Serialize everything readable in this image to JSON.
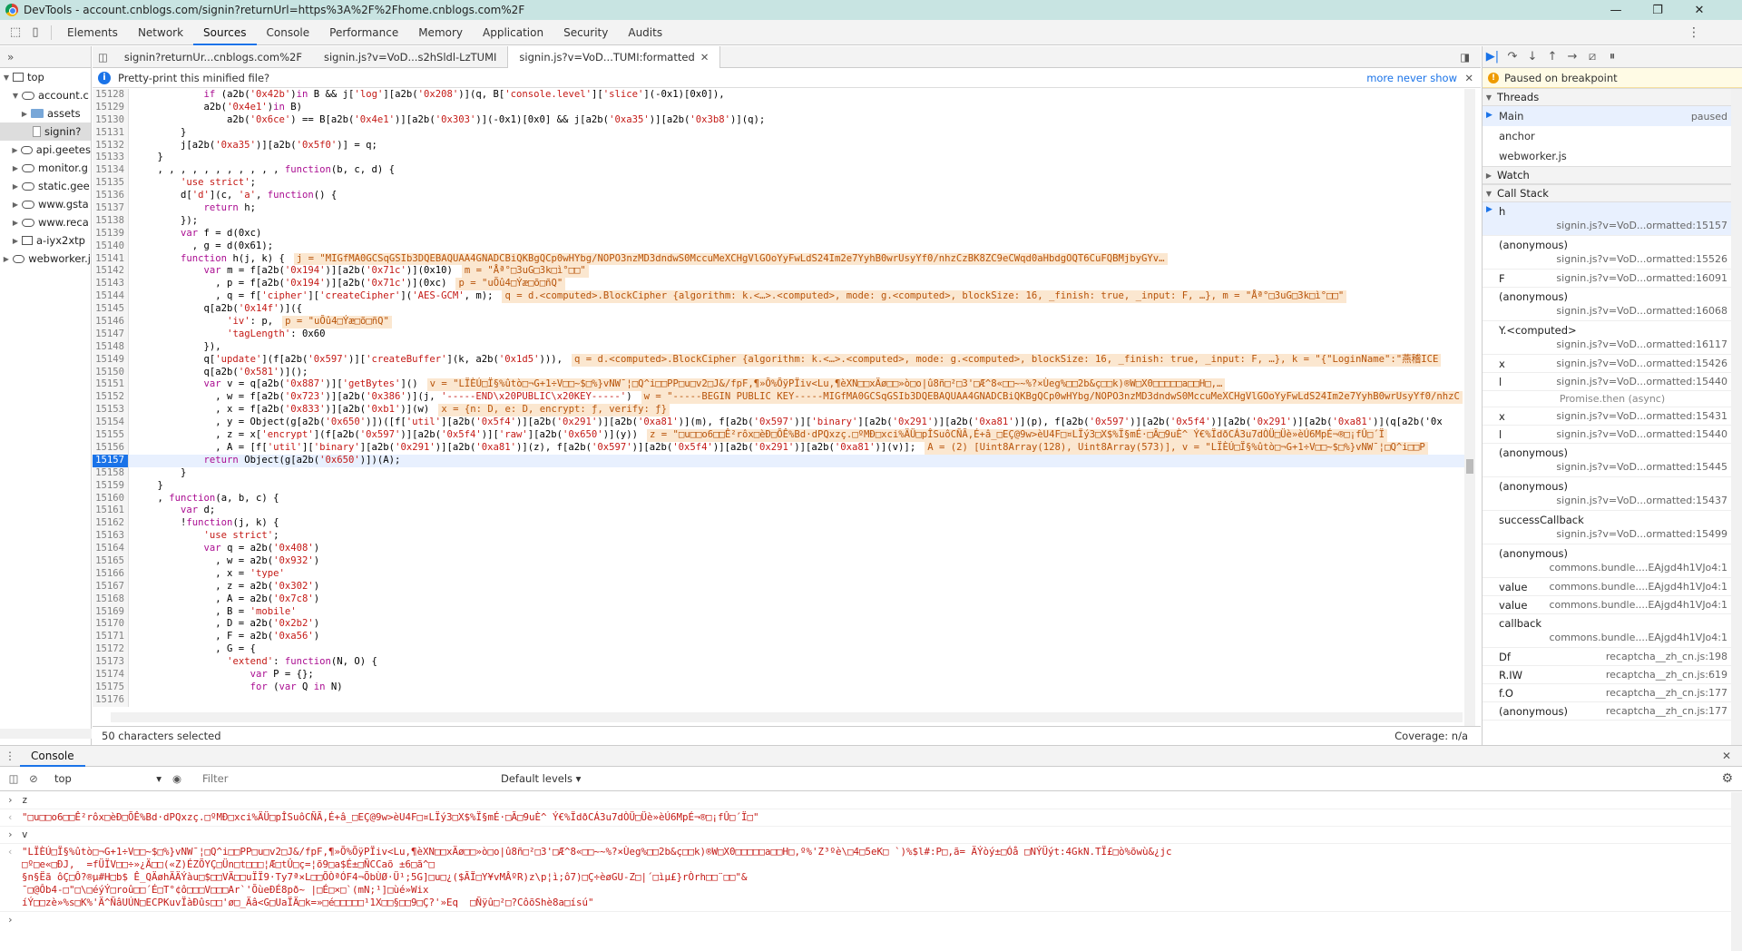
{
  "window": {
    "title": "DevTools - account.cnblogs.com/signin?returnUrl=https%3A%2F%2Fhome.cnblogs.com%2F",
    "minimize": "—",
    "restore": "❐",
    "close": "✕"
  },
  "devtools_tabs": [
    "Elements",
    "Network",
    "Sources",
    "Console",
    "Performance",
    "Memory",
    "Application",
    "Security",
    "Audits"
  ],
  "active_tab": "Sources",
  "navigator": {
    "header": "»",
    "items": [
      {
        "label": "top",
        "indent": 0,
        "icon": "frame"
      },
      {
        "label": "account.c",
        "indent": 1,
        "icon": "cloud"
      },
      {
        "label": "assets",
        "indent": 2,
        "icon": "folder"
      },
      {
        "label": "signin?",
        "indent": 2,
        "icon": "doc"
      },
      {
        "label": "api.geetes",
        "indent": 1,
        "icon": "cloud"
      },
      {
        "label": "monitor.g",
        "indent": 1,
        "icon": "cloud"
      },
      {
        "label": "static.gee",
        "indent": 1,
        "icon": "cloud"
      },
      {
        "label": "www.gsta",
        "indent": 1,
        "icon": "cloud"
      },
      {
        "label": "www.reca",
        "indent": 1,
        "icon": "cloud"
      },
      {
        "label": "a-iyx2xtp",
        "indent": 1,
        "icon": "frame"
      },
      {
        "label": "webworker.j",
        "indent": 0,
        "icon": "cloud"
      }
    ]
  },
  "file_tabs": [
    {
      "label": "signin?returnUr...cnblogs.com%2F",
      "active": false
    },
    {
      "label": "signin.js?v=VoD...s2hSldl-LzTUMI",
      "active": false
    },
    {
      "label": "signin.js?v=VoD...TUMI:formatted",
      "active": true
    }
  ],
  "infobar": {
    "text": "Pretty-print this minified file?",
    "more": "more",
    "never": "never show"
  },
  "code_lines": [
    {
      "n": "15128",
      "t": "            if (a2b('0x42b')in B && j['log'][a2b('0x208')](q, B['console.level']['slice'](-0x1)[0x0]),",
      "i": ""
    },
    {
      "n": "15129",
      "t": "            a2b('0x4e1')in B)",
      "i": ""
    },
    {
      "n": "15130",
      "t": "                a2b('0x6ce') == B[a2b('0x4e1')][a2b('0x303')](-0x1)[0x0] && j[a2b('0xa35')][a2b('0x3b8')](q);",
      "i": ""
    },
    {
      "n": "15131",
      "t": "        }",
      "i": ""
    },
    {
      "n": "15132",
      "t": "        j[a2b('0xa35')][a2b('0x5f0')] = q;",
      "i": ""
    },
    {
      "n": "15133",
      "t": "    }",
      "i": ""
    },
    {
      "n": "15134",
      "t": "    , , , , , , , , , , , function(b, c, d) {",
      "i": ""
    },
    {
      "n": "15135",
      "t": "        'use strict';",
      "i": ""
    },
    {
      "n": "15136",
      "t": "        d['d'](c, 'a', function() {",
      "i": ""
    },
    {
      "n": "15137",
      "t": "            return h;",
      "i": ""
    },
    {
      "n": "15138",
      "t": "        });",
      "i": ""
    },
    {
      "n": "15139",
      "t": "        var f = d(0xc)",
      "i": ""
    },
    {
      "n": "15140",
      "t": "          , g = d(0x61);",
      "i": ""
    },
    {
      "n": "15141",
      "t": "        function h(j, k) {",
      "i": "j = \"MIGfMA0GCSqGSIb3DQEBAQUAA4GNADCBiQKBgQCp0wHYbg/NOPO3nzMD3dndwS0MccuMeXCHgVlGOoYyFwLdS24Im2e7YyhB0wrUsyYf0/nhzCzBK8ZC9eCWqd0aHbdgOQT6CuFQBMjbyGYv…"
    },
    {
      "n": "15142",
      "t": "            var m = f[a2b('0x194')][a2b('0x71c')](0x10)",
      "i": "m = \"Åª°□3uG□3k□ì°□□\""
    },
    {
      "n": "15143",
      "t": "              , p = f[a2b('0x194')][a2b('0x71c')](0xc)",
      "i": "p = \"uÕû4□Ýæ□õ□ñQ\""
    },
    {
      "n": "15144",
      "t": "              , q = f['cipher']['createCipher']('AES-GCM', m);",
      "i": "q = d.<computed>.BlockCipher {algorithm: k.<…>.<computed>, mode: g.<computed>, blockSize: 16, _finish: true, _input: F, …}, m = \"Åª°□3uG□3k□ì°□□\""
    },
    {
      "n": "15145",
      "t": "            q[a2b('0x14f')]({",
      "i": ""
    },
    {
      "n": "15146",
      "t": "                'iv': p,",
      "i": "p = \"uÕû4□Ýæ□õ□ñQ\""
    },
    {
      "n": "15147",
      "t": "                'tagLength': 0x60",
      "i": ""
    },
    {
      "n": "15148",
      "t": "            }),",
      "i": ""
    },
    {
      "n": "15149",
      "t": "            q['update'](f[a2b('0x597')]['createBuffer'](k, a2b('0x1d5'))),",
      "i": "q = d.<computed>.BlockCipher {algorithm: k.<…>.<computed>, mode: g.<computed>, blockSize: 16, _finish: true, _input: F, …}, k = \"{\"LoginName\":\"燕稽ICE"
    },
    {
      "n": "15150",
      "t": "            q[a2b('0x581')]();",
      "i": ""
    },
    {
      "n": "15151",
      "t": "            var v = q[a2b('0x887')]['getBytes']()",
      "i": "v = \"LÏÈÚ□Ï§%ûtò□¬G+1÷V□□~$□%}vNW¯¦□Q^i□□PP□u□v2□J&/fpF,¶»Õ%ÕÿPÏiv<Lu,¶èXN□□xÄø□□»ò□o|û8ñ□²□3'□Æ^8«□□~~%?×Ùeg%□□2b&ç□□k)®W□X0□□□□□a□□H□,…"
    },
    {
      "n": "15152",
      "t": "              , w = f[a2b('0x723')][a2b('0x386')](j, '-----END\\x20PUBLIC\\x20KEY-----')",
      "i": "w = \"-----BEGIN PUBLIC KEY-----MIGfMA0GCSqGSIb3DQEBAQUAA4GNADCBiQKBgQCp0wHYbg/NOPO3nzMD3dndwS0MccuMeXCHgVlGOoYyFwLdS24Im2e7YyhB0wrUsyYf0/nhzC"
    },
    {
      "n": "15153",
      "t": "              , x = f[a2b('0x833')][a2b('0xb1')](w)",
      "i": "x = {n: D, e: D, encrypt: ƒ, verify: ƒ}"
    },
    {
      "n": "15154",
      "t": "              , y = Object(g[a2b('0x650')])([f['util'][a2b('0x5f4')][a2b('0x291')][a2b('0xa81')](m), f[a2b('0x597')]['binary'][a2b('0x291')][a2b('0xa81')](p), f[a2b('0x597')][a2b('0x5f4')][a2b('0x291')][a2b('0xa81')](q[a2b('0x",
      "i": ""
    },
    {
      "n": "15155",
      "t": "              , z = x['encrypt'](f[a2b('0x597')][a2b('0x5f4')]['raw'][a2b('0x650')](y))",
      "i": "z = \"□u□□o6□□Ê²rôx□èÐ□ÕÊ%Bd·dPQxzç.□ºMÐ□xci%ÄÜ□pÎSuôCÑÃ,É+â_□EÇ@9w>èU4F□¤LÏý3□X$%Ï§mÉ·□Ã□9uÈ^ Ý€%ÏdðCÁ3u7dÒÜ□Üè»èÚ6MpÉ¬®□¡fÛ□´Ï"
    },
    {
      "n": "15156",
      "t": "              , A = [f['util']['binary'][a2b('0x291')][a2b('0xa81')](z), f[a2b('0x597')][a2b('0x5f4')][a2b('0x291')][a2b('0xa81')](v)];",
      "i": "A = (2) [Uint8Array(128), Uint8Array(573)], v = \"LÏÈÚ□Ï§%ûtò□¬G+1÷V□□~$□%}vNW¯¦□Q^i□□P"
    },
    {
      "n": "15157",
      "t": "            return Object(g[a2b('0x650')])(A);",
      "i": "",
      "current": true
    },
    {
      "n": "15158",
      "t": "        }",
      "i": ""
    },
    {
      "n": "15159",
      "t": "    }",
      "i": ""
    },
    {
      "n": "15160",
      "t": "    , function(a, b, c) {",
      "i": ""
    },
    {
      "n": "15161",
      "t": "        var d;",
      "i": ""
    },
    {
      "n": "15162",
      "t": "        !function(j, k) {",
      "i": ""
    },
    {
      "n": "15163",
      "t": "            'use strict';",
      "i": ""
    },
    {
      "n": "15164",
      "t": "            var q = a2b('0x408')",
      "i": ""
    },
    {
      "n": "15165",
      "t": "              , w = a2b('0x932')",
      "i": ""
    },
    {
      "n": "15166",
      "t": "              , x = 'type'",
      "i": ""
    },
    {
      "n": "15167",
      "t": "              , z = a2b('0x302')",
      "i": ""
    },
    {
      "n": "15168",
      "t": "              , A = a2b('0x7c8')",
      "i": ""
    },
    {
      "n": "15169",
      "t": "              , B = 'mobile'",
      "i": ""
    },
    {
      "n": "15170",
      "t": "              , D = a2b('0x2b2')",
      "i": ""
    },
    {
      "n": "15171",
      "t": "              , F = a2b('0xa56')",
      "i": ""
    },
    {
      "n": "15172",
      "t": "              , G = {",
      "i": ""
    },
    {
      "n": "15173",
      "t": "                'extend': function(N, O) {",
      "i": ""
    },
    {
      "n": "15174",
      "t": "                    var P = {};",
      "i": ""
    },
    {
      "n": "15175",
      "t": "                    for (var Q in N)",
      "i": ""
    },
    {
      "n": "15176",
      "t": "",
      "i": ""
    }
  ],
  "status": {
    "selected": "50 characters selected",
    "coverage": "Coverage: n/a"
  },
  "debugger": {
    "paused_msg": "Paused on breakpoint",
    "threads_title": "Threads",
    "threads": [
      {
        "name": "Main",
        "state": "paused",
        "sel": true
      },
      {
        "name": "anchor",
        "state": ""
      },
      {
        "name": "webworker.js",
        "state": ""
      }
    ],
    "watch_title": "Watch",
    "callstack_title": "Call Stack",
    "frames": [
      {
        "fn": "h",
        "loc": "signin.js?v=VoD...ormatted:15157",
        "sel": true
      },
      {
        "fn": "(anonymous)",
        "loc": "signin.js?v=VoD...ormatted:15526"
      },
      {
        "fn": "F",
        "loc": "signin.js?v=VoD...ormatted:16091",
        "one": true
      },
      {
        "fn": "(anonymous)",
        "loc": "signin.js?v=VoD...ormatted:16068"
      },
      {
        "fn": "Y.<computed>",
        "loc": "signin.js?v=VoD...ormatted:16117"
      },
      {
        "fn": "x",
        "loc": "signin.js?v=VoD...ormatted:15426",
        "one": true
      },
      {
        "fn": "l",
        "loc": "signin.js?v=VoD...ormatted:15440",
        "one": true
      },
      {
        "async": "Promise.then (async)"
      },
      {
        "fn": "x",
        "loc": "signin.js?v=VoD...ormatted:15431",
        "one": true
      },
      {
        "fn": "l",
        "loc": "signin.js?v=VoD...ormatted:15440",
        "one": true
      },
      {
        "fn": "(anonymous)",
        "loc": "signin.js?v=VoD...ormatted:15445"
      },
      {
        "fn": "(anonymous)",
        "loc": "signin.js?v=VoD...ormatted:15437"
      },
      {
        "fn": "successCallback",
        "loc": "signin.js?v=VoD...ormatted:15499"
      },
      {
        "fn": "(anonymous)",
        "loc": "commons.bundle....EAjgd4h1VJo4:1"
      },
      {
        "fn": "value",
        "loc": "commons.bundle....EAjgd4h1VJo4:1",
        "one": true
      },
      {
        "fn": "value",
        "loc": "commons.bundle....EAjgd4h1VJo4:1",
        "one": true
      },
      {
        "fn": "callback",
        "loc": "commons.bundle....EAjgd4h1VJo4:1"
      },
      {
        "fn": "Df",
        "loc": "recaptcha__zh_cn.js:198",
        "one": true
      },
      {
        "fn": "R.IW",
        "loc": "recaptcha__zh_cn.js:619",
        "one": true
      },
      {
        "fn": "f.O",
        "loc": "recaptcha__zh_cn.js:177",
        "one": true
      },
      {
        "fn": "(anonymous)",
        "loc": "recaptcha__zh_cn.js:177",
        "one": true
      }
    ]
  },
  "console": {
    "tab": "Console",
    "context": "top",
    "filter_placeholder": "Filter",
    "levels": "Default levels ▾",
    "lines": [
      {
        "kind": "in",
        "text": "z"
      },
      {
        "kind": "out",
        "text": "\"□u□□o6□□Ê²rôx□èÐ□ÕÊ%Bd·dPQxzç.□ºMÐ□xci%ÄÜ□pÎSuôCÑÃ,É+â_□EÇ@9w>èU4F□¤LÏý3□X$%Ï§mÉ·□Ã□9uÈ^ Ý€%ÏdðCÁ3u7dÒÜ□Üè»èÚ6MpÉ¬®□¡fÛ□´Ï□\""
      },
      {
        "kind": "in",
        "text": "v"
      },
      {
        "kind": "out",
        "text": "\"LÏÈÚ□Ï§%ûtò□¬G+1÷V□□~$□%}vNW¯¦□Q^i□□PP□u□v2□J&/fpF,¶»Õ%ÕÿPÏiv<Lu,¶èXN□□xÄø□□»ò□o|û8ñ□²□3'□Æ^8«□□~~%?×Ùeg%□□2b&ç□□k)®W□X0□□□□□a□□H□,º%'Z³ºè\\□4□5eK□ `)%$l#:P□,ã= ÄÝòý±□Óå □NÝÜýt:4GkN.TÏ£□ò%õwù&¿jc\n□º□e«□ÐJ,  =fÜÏV□□÷»¿Ä□□(«Z)ÉZÕYÇ□Ün□t□□□¦Æ□tÛ□ç=¦õ9□a$É±□ÑCCaõ ±6□ã^□\n§n§Ëã ôÇ□Ô?®µ#H□b$ Ê_QÄøhÄÄÝàu□$□□VÄ□□uÏÏ9·Ty7ª×L□□ÕÒªÓF4¬ÕbÙØ·Ü¹;5G]□u□¿($ÃÏ□Y¥vMÂºR)z\\p¦ì;ô7)□Ç÷èøGU-Z□|´□ìµ£}rÒrh□□¨□□\"&\n¯□@Ôb4-□\"□\\□éýÝ□roû□□´É□T°¢ô□□□V□□□Ar`'ÕùeÐÉ8pð~ |□É□×□`(mN;¹]□ùé»Wix\níÝ□□zè»%s□K%'Ä^ÑâUÚN□ECPKuvÏàÐûs□□'ø□_Äâ<G□UaÏÄ□k=»□é□□□□□¹1X□□§□□9□Ç?'»Eq  □Ñÿû□²□?CôõShè8a□ísú\""
      },
      {
        "kind": "prompt",
        "text": ""
      }
    ]
  }
}
